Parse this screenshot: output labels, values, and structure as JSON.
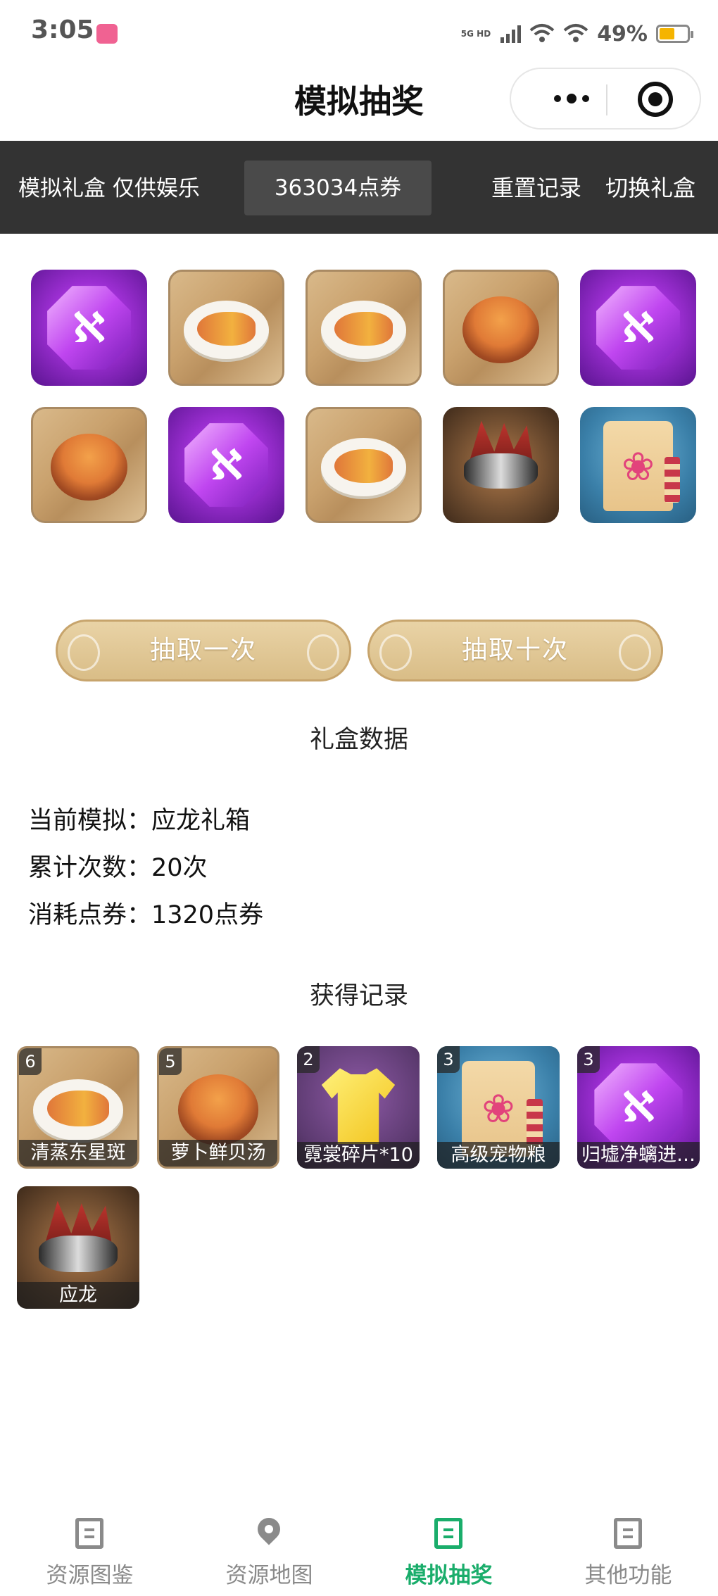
{
  "status_bar": {
    "time": "3:05",
    "network": "5G HD",
    "battery": "49%",
    "battery_level": 0.49
  },
  "nav": {
    "title": "模拟抽奖"
  },
  "toolbar": {
    "note": "模拟礼盒 仅供娱乐",
    "points": "363034点券",
    "reset_label": "重置记录",
    "switch_label": "切换礼盒"
  },
  "prize_grid": [
    {
      "icon": "purple-gem-icon"
    },
    {
      "icon": "steamed-fish-icon"
    },
    {
      "icon": "steamed-fish-icon"
    },
    {
      "icon": "scallop-soup-icon"
    },
    {
      "icon": "purple-gem-icon"
    },
    {
      "icon": "scallop-soup-icon"
    },
    {
      "icon": "purple-gem-icon"
    },
    {
      "icon": "steamed-fish-icon"
    },
    {
      "icon": "dragon-mount-icon"
    },
    {
      "icon": "pet-food-bag-icon"
    }
  ],
  "actions": {
    "draw_once": "抽取一次",
    "draw_ten": "抽取十次"
  },
  "stats": {
    "section_title": "礼盒数据",
    "current_box_line": "当前模拟：应龙礼箱",
    "total_draws_line": "累计次数：20次",
    "spent_line": "消耗点券：1320点券"
  },
  "records": {
    "section_title": "获得记录",
    "items": [
      {
        "count": "6",
        "name": "清蒸东星斑",
        "icon": "steamed-fish-icon"
      },
      {
        "count": "5",
        "name": "萝卜鲜贝汤",
        "icon": "scallop-soup-icon"
      },
      {
        "count": "2",
        "name": "霓裳碎片*10",
        "icon": "yellow-shirt-icon"
      },
      {
        "count": "3",
        "name": "高级宠物粮",
        "icon": "pet-food-bag-icon"
      },
      {
        "count": "3",
        "name": "归墟净螭进…",
        "icon": "purple-gem-icon"
      },
      {
        "count": "",
        "name": "应龙",
        "icon": "dragon-mount-icon"
      }
    ]
  },
  "tabbar": {
    "tabs": [
      {
        "label": "资源图鉴",
        "icon": "doc-icon",
        "active": false
      },
      {
        "label": "资源地图",
        "icon": "map-pin-icon",
        "active": false
      },
      {
        "label": "模拟抽奖",
        "icon": "doc-icon",
        "active": true
      },
      {
        "label": "其他功能",
        "icon": "doc-icon",
        "active": false
      }
    ],
    "active_color": "#1aad6b",
    "inactive_color": "#8a8a8a"
  }
}
